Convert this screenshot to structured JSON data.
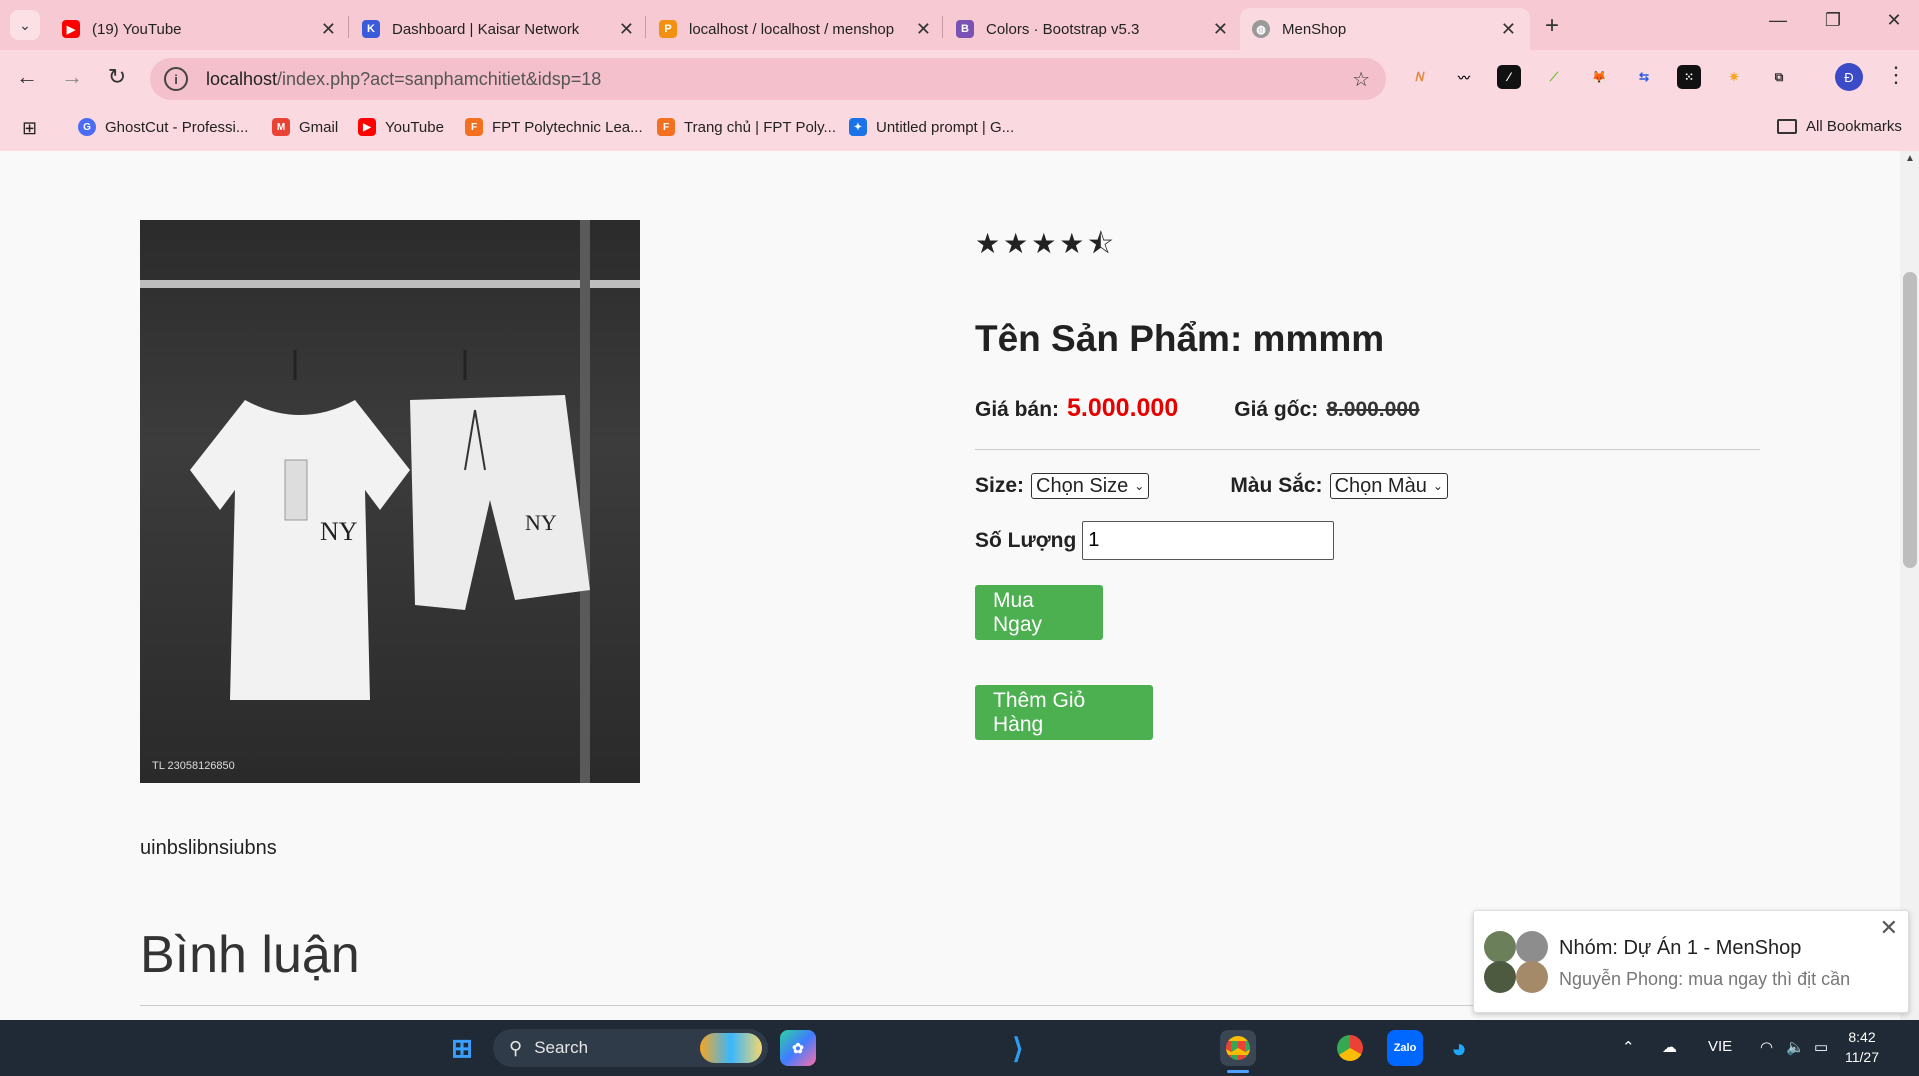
{
  "browser": {
    "tabs": [
      {
        "title": "(19) YouTube",
        "icon": "youtube-icon",
        "color": "#ff0000",
        "active": false
      },
      {
        "title": "Dashboard | Kaisar Network",
        "icon": "kaisar-icon",
        "color": "#3b5bdb",
        "active": false
      },
      {
        "title": "localhost / localhost / menshop",
        "icon": "phpmyadmin-icon",
        "color": "#f29111",
        "active": false
      },
      {
        "title": "Colors · Bootstrap v5.3",
        "icon": "bootstrap-icon",
        "color": "#7952b3",
        "active": false
      },
      {
        "title": "MenShop",
        "icon": "globe-icon",
        "color": "#999999",
        "active": true
      }
    ],
    "url_host": "localhost",
    "url_path": "/index.php?act=sanphamchitiet&idsp=18",
    "profile_initial": "Đ",
    "bookmarks": [
      {
        "label": "GhostCut - Professi...",
        "color": "#4a6cf7"
      },
      {
        "label": "Gmail",
        "color": "#ea4335"
      },
      {
        "label": "YouTube",
        "color": "#ff0000"
      },
      {
        "label": "FPT Polytechnic Lea...",
        "color": "#f37021"
      },
      {
        "label": "Trang chủ | FPT Poly...",
        "color": "#f37021"
      },
      {
        "label": "Untitled prompt | G...",
        "color": "#1a73e8"
      }
    ],
    "all_bookmarks_label": "All Bookmarks"
  },
  "product": {
    "rating": "★★★★⯪",
    "name": "Tên Sản Phẩm: mmmm",
    "sale_label": "Giá bán:",
    "sale_price": "5.000.000",
    "orig_label": "Giá gốc:",
    "orig_price": "8.000.000",
    "size_label": "Size:",
    "size_value": "Chọn Size",
    "color_label": "Màu Sắc:",
    "color_value": "Chọn Màu",
    "qty_label": "Số Lượng",
    "qty_value": "1",
    "buy_label": "Mua Ngay",
    "cart_label": "Thêm Giỏ Hàng",
    "image_code": "TL 23058126850",
    "description": "uinbslibnsiubns",
    "comments_title": "Bình luận"
  },
  "toast": {
    "title": "Nhóm: Dự Án 1 - MenShop",
    "message": "Nguyễn Phong: mua ngay thì địt cần"
  },
  "taskbar": {
    "search_label": "Search",
    "language": "VIE",
    "time": "8:42",
    "date": "11/27"
  }
}
